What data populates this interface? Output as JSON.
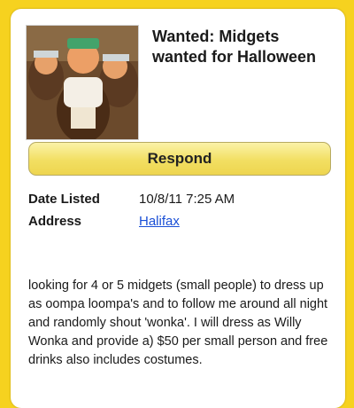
{
  "listing": {
    "title": "Wanted: Midgets wanted for Halloween",
    "respond_label": "Respond",
    "photo_icon": "listing-photo",
    "details": {
      "date_label": "Date Listed",
      "date_value": "10/8/11 7:25 AM",
      "address_label": "Address",
      "address_value": "Halifax"
    },
    "description": "looking for 4 or 5 midgets (small people) to dress up as oompa loompa's and to follow me around all night and randomly shout 'wonka'. I will dress as Willy Wonka and provide a) $50 per small person and free drinks also includes costumes."
  },
  "colors": {
    "background": "#f6d21f",
    "card": "#ffffff",
    "button": "#f2df62",
    "link": "#1a4fd6"
  }
}
